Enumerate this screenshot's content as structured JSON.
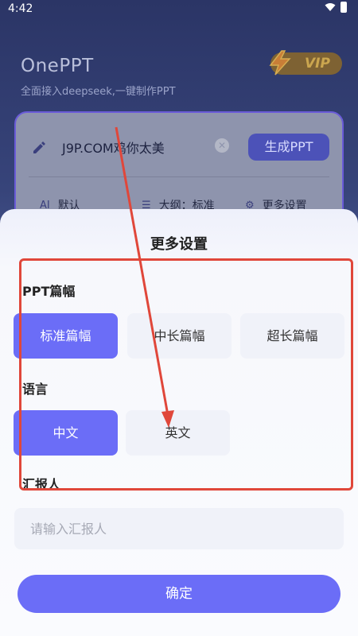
{
  "status_bar": {
    "time": "4:42"
  },
  "app": {
    "title": "OnePPT",
    "subtitle": "全面接入deepseek,一键制作PPT",
    "vip_label": "VIP"
  },
  "card": {
    "prompt_text": "J9P.COM鸡你太美",
    "generate_label": "生成PPT",
    "options": {
      "model_label": "默认",
      "outline_label": "大纲：标准",
      "more_label": "更多设置"
    }
  },
  "sheet": {
    "title": "更多设置",
    "ppt_length": {
      "label": "PPT篇幅",
      "options": [
        "标准篇幅",
        "中长篇幅",
        "超长篇幅"
      ],
      "selected": 0
    },
    "language": {
      "label": "语言",
      "options": [
        "中文",
        "英文"
      ],
      "selected": 0
    },
    "reporter": {
      "label": "汇报人",
      "placeholder": "请输入汇报人",
      "value": ""
    },
    "confirm_label": "确定"
  },
  "colors": {
    "accent": "#6b6df7",
    "annotation_red": "#e0473a"
  },
  "icons": [
    "wifi-icon",
    "battery-icon",
    "pen-icon",
    "clear-icon",
    "ai-icon",
    "list-icon",
    "gear-icon",
    "lightning-icon"
  ]
}
